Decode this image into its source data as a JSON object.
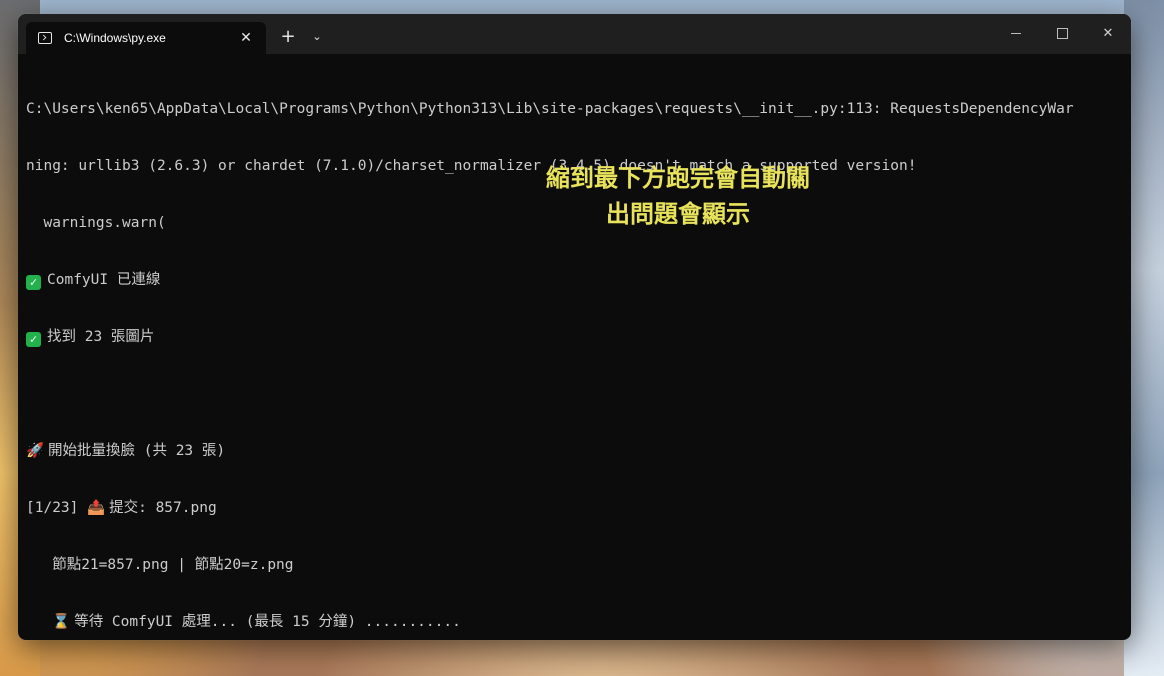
{
  "window": {
    "tab_title": "C:\\Windows\\py.exe",
    "tab_close": "✕",
    "new_tab": "+",
    "dropdown": "⌄",
    "close_glyph": "✕"
  },
  "terminal": {
    "lines": [
      "C:\\Users\\ken65\\AppData\\Local\\Programs\\Python\\Python313\\Lib\\site-packages\\requests\\__init__.py:113: RequestsDependencyWar",
      "ning: urllib3 (2.6.3) or chardet (7.1.0)/charset_normalizer (3.4.5) doesn't match a supported version!",
      "  warnings.warn(",
      "ComfyUI 已連線",
      "找到 23 張圖片",
      "",
      "開始批量換臉 (共 23 張)",
      "[1/23] ",
      "提交: 857.png",
      "   節點21=857.png | 節點20=z.png",
      "等待 ComfyUI 處理... (最長 15 分鐘) ..........."
    ],
    "check_glyph": "✓",
    "rocket_glyph": "🚀",
    "outbox_glyph": "📤",
    "hourglass_glyph": "⌛"
  },
  "annotation": {
    "line1": "縮到最下方跑完會自動關",
    "line2": "出問題會顯示"
  },
  "icons": {
    "terminal": "terminal-icon",
    "check": "check-icon",
    "rocket": "rocket-icon",
    "outbox": "outbox-icon",
    "hourglass": "hourglass-icon"
  },
  "colors": {
    "terminal_bg": "#0c0c0c",
    "terminal_text": "#cccccc",
    "annotation": "#e8e35a",
    "check_bg": "#22b14c"
  }
}
